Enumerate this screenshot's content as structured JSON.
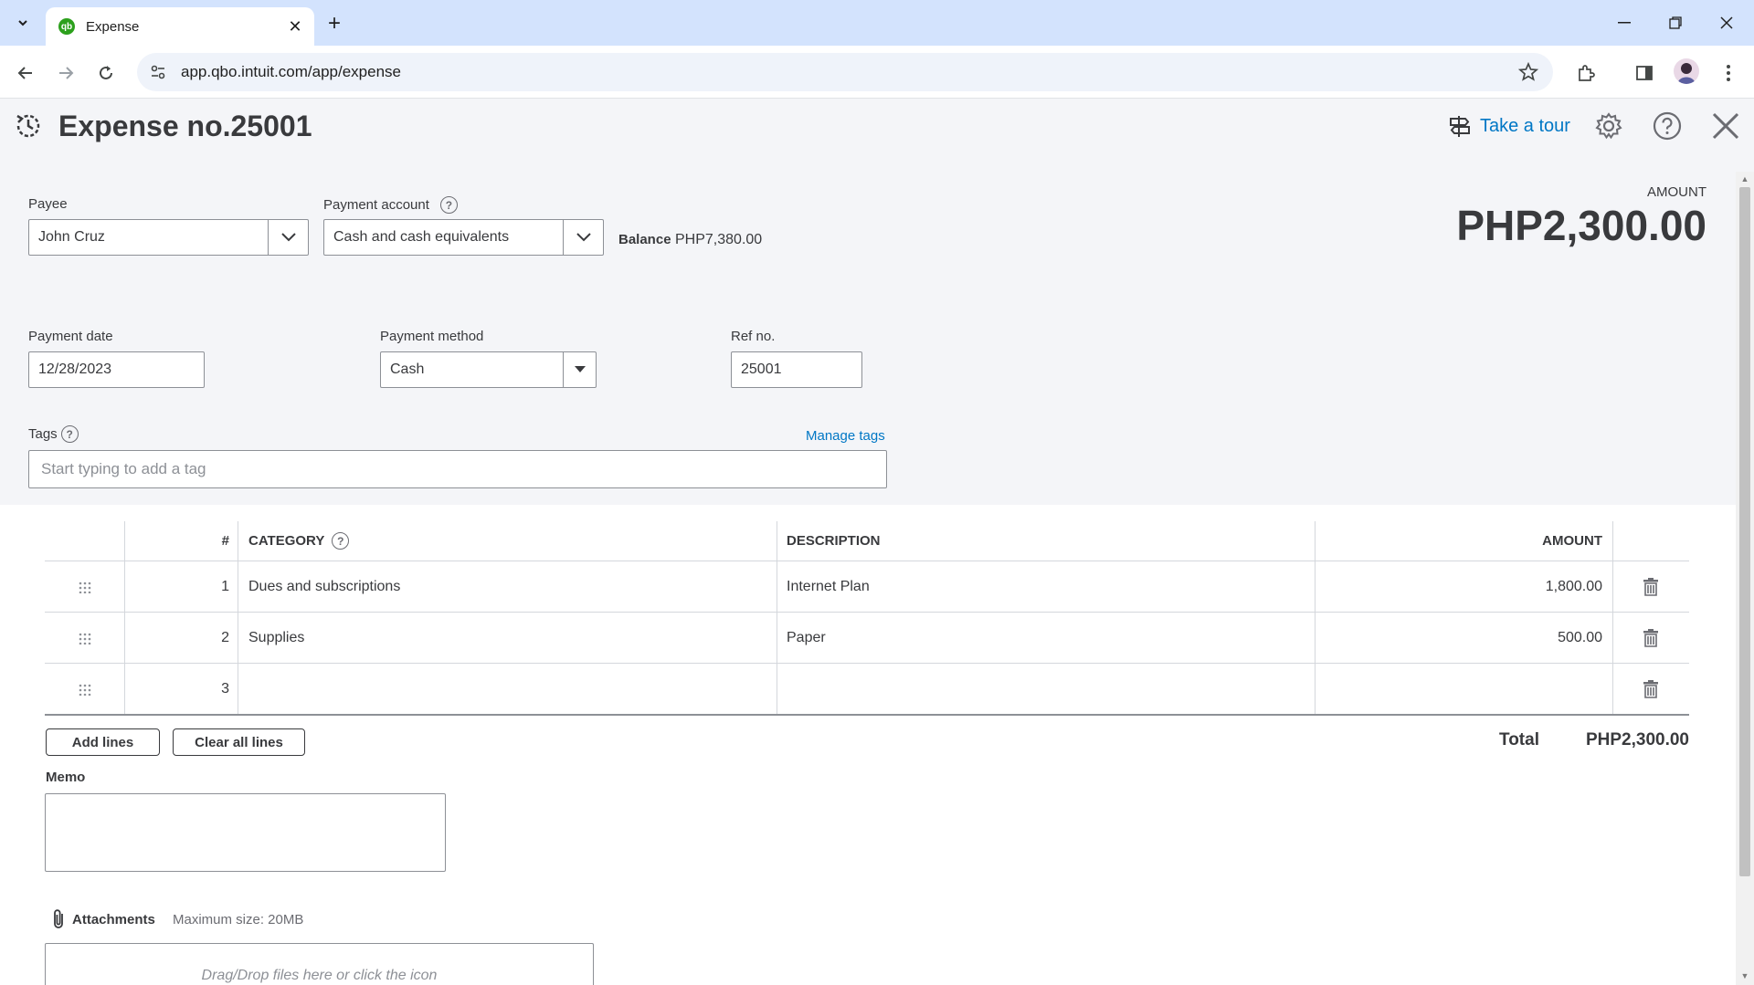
{
  "browser": {
    "tab_title": "Expense",
    "favicon_text": "qb",
    "url": "app.qbo.intuit.com/app/expense"
  },
  "header": {
    "title": "Expense no.25001",
    "tour_label": "Take a tour"
  },
  "form": {
    "payee_label": "Payee",
    "payee_value": "John Cruz",
    "payment_account_label": "Payment account",
    "payment_account_value": "Cash and cash equivalents",
    "balance_label": "Balance",
    "balance_value": "PHP7,380.00",
    "amount_label": "AMOUNT",
    "amount_value": "PHP2,300.00",
    "payment_date_label": "Payment date",
    "payment_date_value": "12/28/2023",
    "payment_method_label": "Payment method",
    "payment_method_value": "Cash",
    "ref_label": "Ref no.",
    "ref_value": "25001",
    "tags_label": "Tags",
    "manage_tags": "Manage tags",
    "tags_placeholder": "Start typing to add a tag"
  },
  "table": {
    "headers": {
      "num": "#",
      "category": "CATEGORY",
      "description": "DESCRIPTION",
      "amount": "AMOUNT"
    },
    "rows": [
      {
        "num": "1",
        "category": "Dues and subscriptions",
        "description": "Internet Plan",
        "amount": "1,800.00"
      },
      {
        "num": "2",
        "category": "Supplies",
        "description": "Paper",
        "amount": "500.00"
      },
      {
        "num": "3",
        "category": "",
        "description": "",
        "amount": ""
      }
    ]
  },
  "actions": {
    "add_lines": "Add lines",
    "clear_lines": "Clear all lines",
    "total_label": "Total",
    "total_value": "PHP2,300.00"
  },
  "memo": {
    "label": "Memo"
  },
  "attachments": {
    "label": "Attachments",
    "max_size": "Maximum size: 20MB",
    "drop_text": "Drag/Drop files here or click the icon"
  },
  "colors": {
    "link": "#0077c5",
    "brand": "#2ca01c",
    "text": "#393a3d",
    "panel_bg": "#f4f5f8"
  }
}
